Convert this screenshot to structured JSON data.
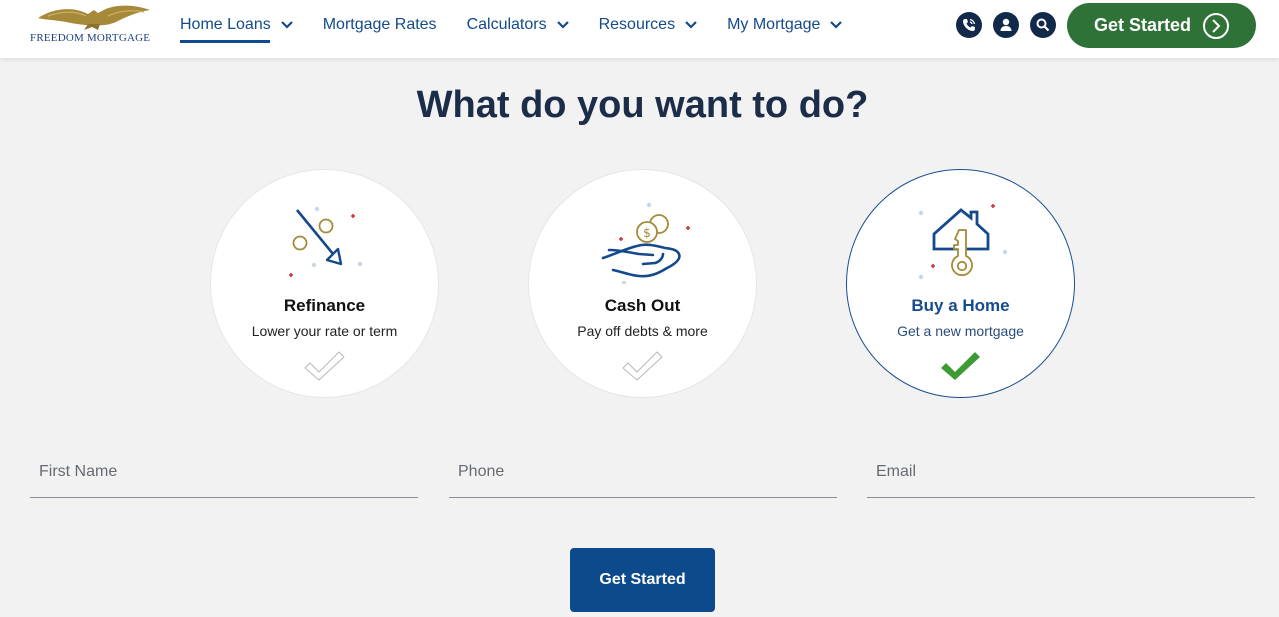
{
  "brand": {
    "name": "FREEDOM MORTGAGE",
    "colors": {
      "navy": "#12294a",
      "blue": "#0d4a8c",
      "green": "#2e7237",
      "gold": "#a68a3a",
      "check_green": "#3d9b35",
      "red_accent": "#d0313a"
    }
  },
  "nav": {
    "items": [
      {
        "label": "Home Loans",
        "dropdown": true,
        "active": true
      },
      {
        "label": "Mortgage Rates",
        "dropdown": false,
        "active": false
      },
      {
        "label": "Calculators",
        "dropdown": true,
        "active": false
      },
      {
        "label": "Resources",
        "dropdown": true,
        "active": false
      },
      {
        "label": "My Mortgage",
        "dropdown": true,
        "active": false
      }
    ],
    "icons": [
      "phone-icon",
      "user-icon",
      "search-icon"
    ],
    "cta_label": "Get Started"
  },
  "main": {
    "title": "What do you want to do?",
    "options": [
      {
        "title": "Refinance",
        "subtitle": "Lower your rate or term",
        "icon": "refinance-arrow-icon",
        "selected": false
      },
      {
        "title": "Cash Out",
        "subtitle": "Pay off debts & more",
        "icon": "hand-coins-icon",
        "selected": false
      },
      {
        "title": "Buy a Home",
        "subtitle": "Get a new mortgage",
        "icon": "house-key-icon",
        "selected": true
      }
    ],
    "form": {
      "first_name": {
        "value": "",
        "placeholder": "First Name"
      },
      "phone": {
        "value": "",
        "placeholder": "Phone"
      },
      "email": {
        "value": "",
        "placeholder": "Email"
      },
      "submit_label": "Get Started"
    }
  }
}
